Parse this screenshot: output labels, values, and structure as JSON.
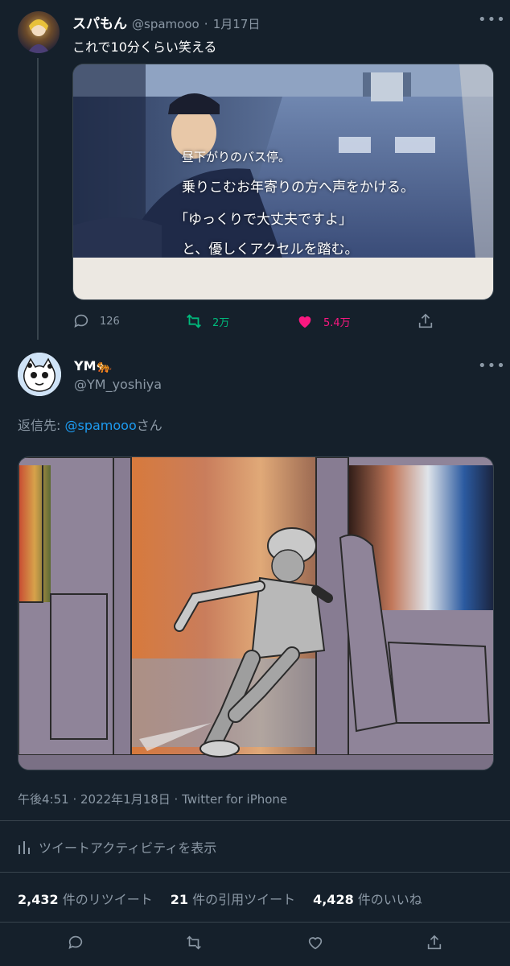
{
  "tweet1": {
    "display_name": "スパもん",
    "handle": "@spamooo",
    "sep": "·",
    "date": "1月17日",
    "text": "これで10分くらい笑える",
    "image_caption_lines": [
      "昼下がりのバス停。",
      "乗りこむお年寄りの方へ声をかける。",
      "「ゆっくりで大丈夫ですよ」",
      "と、優しくアクセルを踏む。"
    ],
    "reply_count": "126",
    "retweet_count": "2万",
    "like_count": "5.4万",
    "more": "•••"
  },
  "tweet2": {
    "display_name": "YM🐅",
    "handle": "@YM_yoshiya",
    "more": "•••",
    "reply_prefix": "返信先: ",
    "reply_to": "@spamooo",
    "reply_suffix": "さん",
    "timestamp": "午後4:51 · 2022年1月18日 · Twitter for iPhone",
    "activity_label": "ツイートアクティビティを表示",
    "retweets_num": "2,432",
    "retweets_label": "件のリツイート",
    "quotes_num": "21",
    "quotes_label": "件の引用ツイート",
    "likes_num": "4,428",
    "likes_label": "件のいいね"
  },
  "colors": {
    "background": "#15202b",
    "muted": "#8b98a5",
    "accent": "#1d9bf0",
    "retweet": "#00ba7c",
    "like": "#f91880",
    "border": "#38444d"
  },
  "icons": [
    "reply-icon",
    "retweet-icon",
    "heart-icon",
    "share-icon",
    "activity-icon",
    "more-icon"
  ]
}
